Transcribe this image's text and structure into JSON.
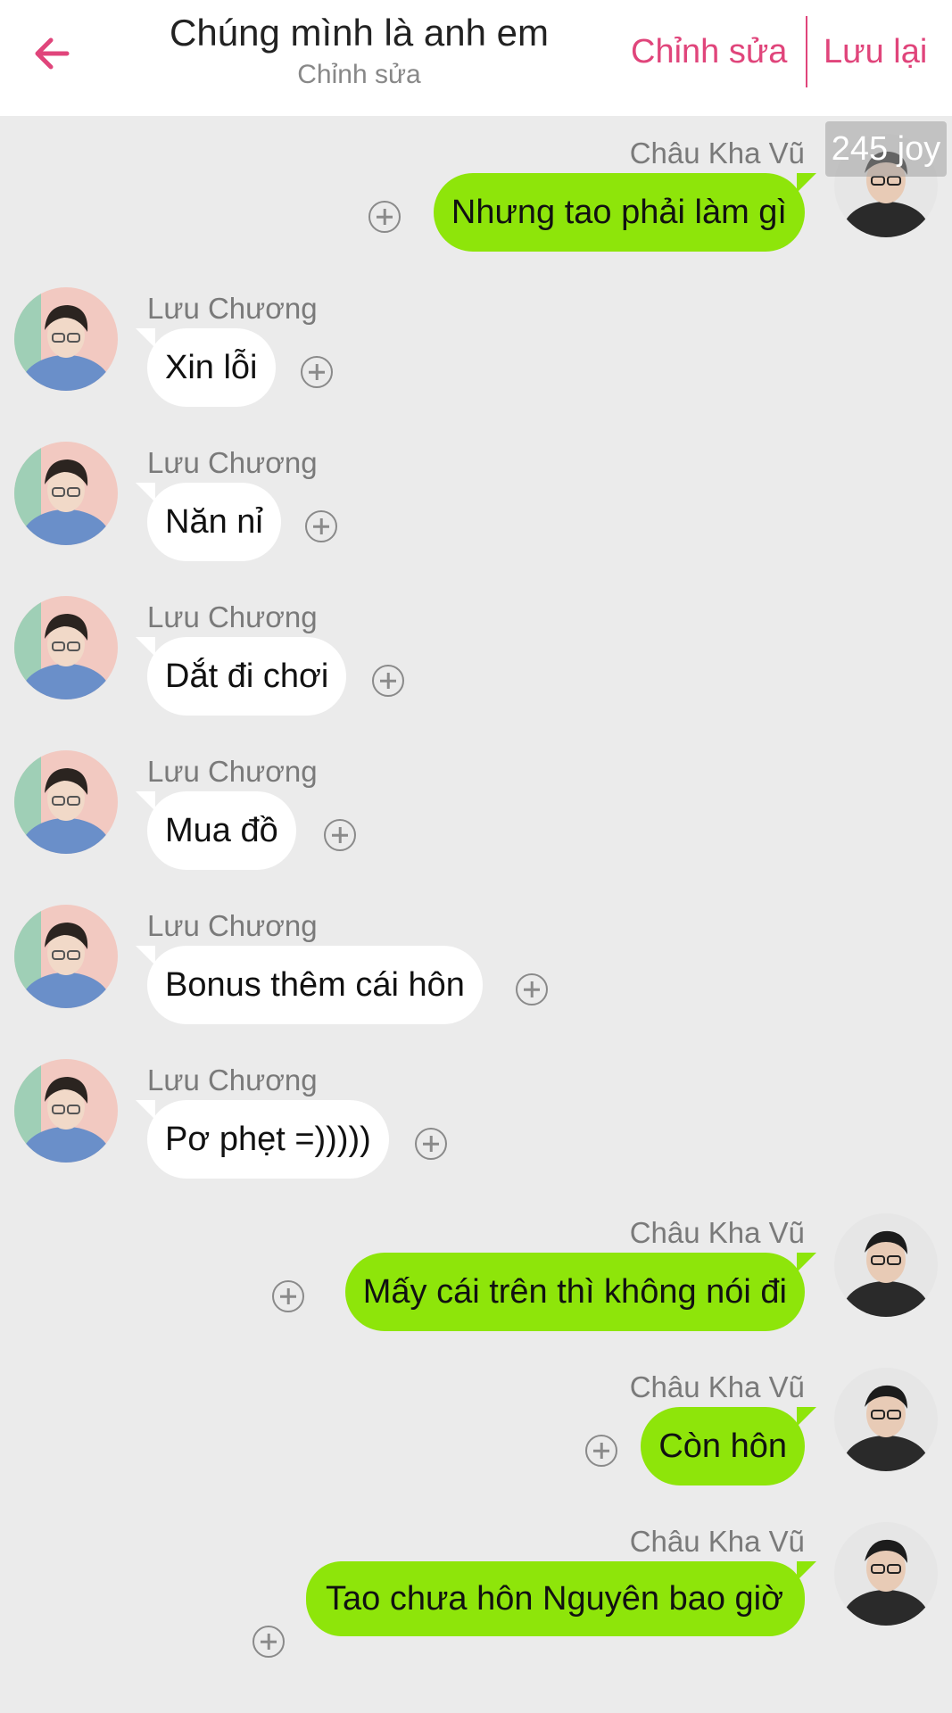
{
  "header": {
    "title": "Chúng mình là anh em",
    "subtitle": "Chỉnh sửa",
    "edit_label": "Chỉnh sửa",
    "save_label": "Lưu lại",
    "accent_color": "#e0457b"
  },
  "watermark": "245 joy",
  "messages": [
    {
      "side": "right",
      "sender": "Châu Kha Vũ",
      "text": "Nhưng tao phải làm gì"
    },
    {
      "side": "left",
      "sender": "Lưu Chương",
      "text": "Xin lỗi"
    },
    {
      "side": "left",
      "sender": "Lưu Chương",
      "text": "Năn nỉ"
    },
    {
      "side": "left",
      "sender": "Lưu Chương",
      "text": "Dắt đi chơi"
    },
    {
      "side": "left",
      "sender": "Lưu Chương",
      "text": "Mua đồ"
    },
    {
      "side": "left",
      "sender": "Lưu Chương",
      "text": "Bonus thêm cái hôn"
    },
    {
      "side": "left",
      "sender": "Lưu Chương",
      "text": "Pơ phẹt =)))))"
    },
    {
      "side": "right",
      "sender": "Châu Kha Vũ",
      "text": "Mấy cái trên thì không nói đi"
    },
    {
      "side": "right",
      "sender": "Châu Kha Vũ",
      "text": "Còn hôn"
    },
    {
      "side": "right",
      "sender": "Châu Kha Vũ",
      "text": "Tao chưa hôn Nguyên bao giờ"
    }
  ],
  "colors": {
    "background": "#ebebeb",
    "bubble_right": "#8ee50a",
    "bubble_left": "#ffffff"
  },
  "icons": {
    "back": "arrow-left-icon",
    "add": "plus-circle-icon"
  }
}
